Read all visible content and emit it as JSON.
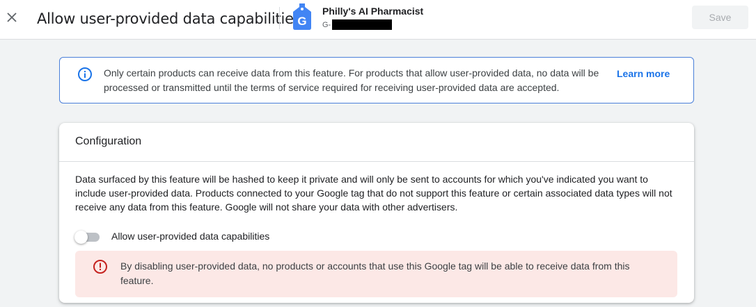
{
  "header": {
    "title": "Allow user-provided data capabilities",
    "account_name": "Philly's AI Pharmacist",
    "account_id_prefix": "G-",
    "save_label": "Save",
    "icons": {
      "close": "close-icon",
      "tag": "google-tag-icon"
    }
  },
  "info_banner": {
    "text": "Only certain products can receive data from this feature. For products that allow user-provided data, no data will be processed or transmitted until the terms of service required for receiving user-provided data are accepted.",
    "link_label": "Learn more",
    "icon": "info-icon",
    "accent_color": "#1a73e8"
  },
  "configuration": {
    "title": "Configuration",
    "description": "Data surfaced by this feature will be hashed to keep it private and will only be sent to accounts for which you've indicated you want to include user-provided data. Products connected to your Google tag that do not support this feature or certain associated data types will not receive any data from this feature. Google will not share your data with other advertisers.",
    "toggle": {
      "label": "Allow user-provided data capabilities",
      "enabled": false
    },
    "warning": {
      "text": "By disabling user-provided data, no products or accounts that use this Google tag will be able to receive data from this feature.",
      "icon": "error-icon",
      "color": "#c5221f",
      "background": "#fce8e6"
    }
  }
}
